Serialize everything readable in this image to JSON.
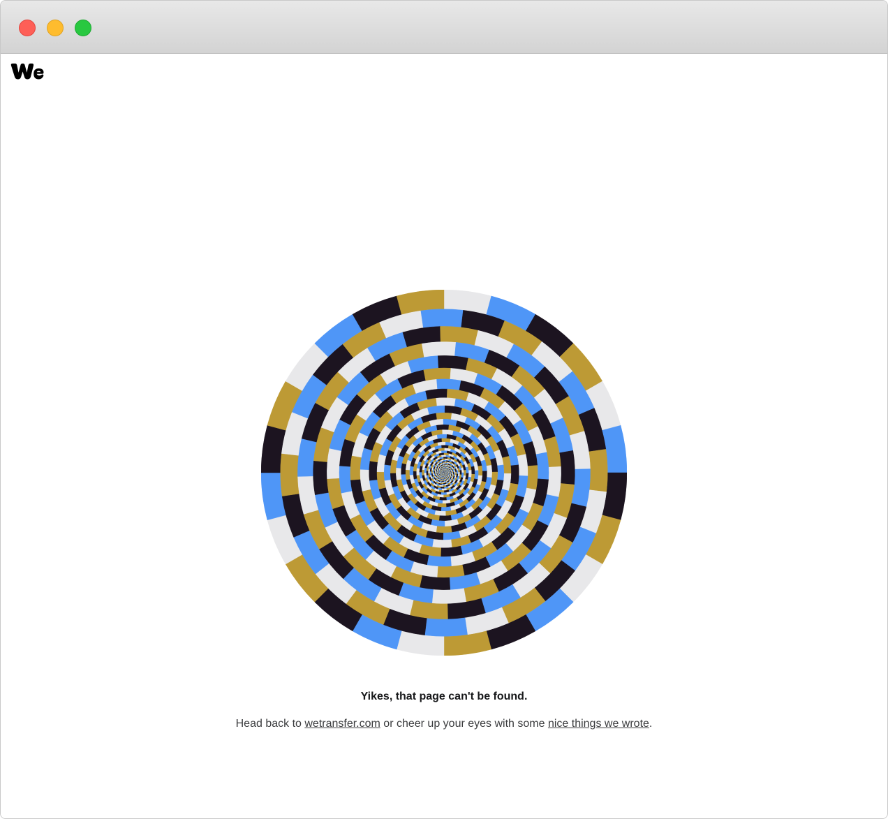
{
  "window": {
    "controls": [
      "close",
      "minimize",
      "maximize"
    ],
    "control_colors": {
      "close": "#fe5f57",
      "minimize": "#febc2e",
      "maximize": "#28c840"
    }
  },
  "header": {
    "logo_icon": "wetransfer-we-logo-icon",
    "logo_text": "we"
  },
  "illustration": {
    "icon": "hypnotic-checkered-spiral",
    "colors": [
      "#e8e8ea",
      "#4f96f7",
      "#1c1420",
      "#bd9a35"
    ]
  },
  "error": {
    "headline": "Yikes, that page can't be found.",
    "prefix": "Head back to ",
    "home_link": "wetransfer.com",
    "middle": " or cheer up your eyes with some ",
    "blog_link": "nice things we wrote",
    "suffix": "."
  }
}
